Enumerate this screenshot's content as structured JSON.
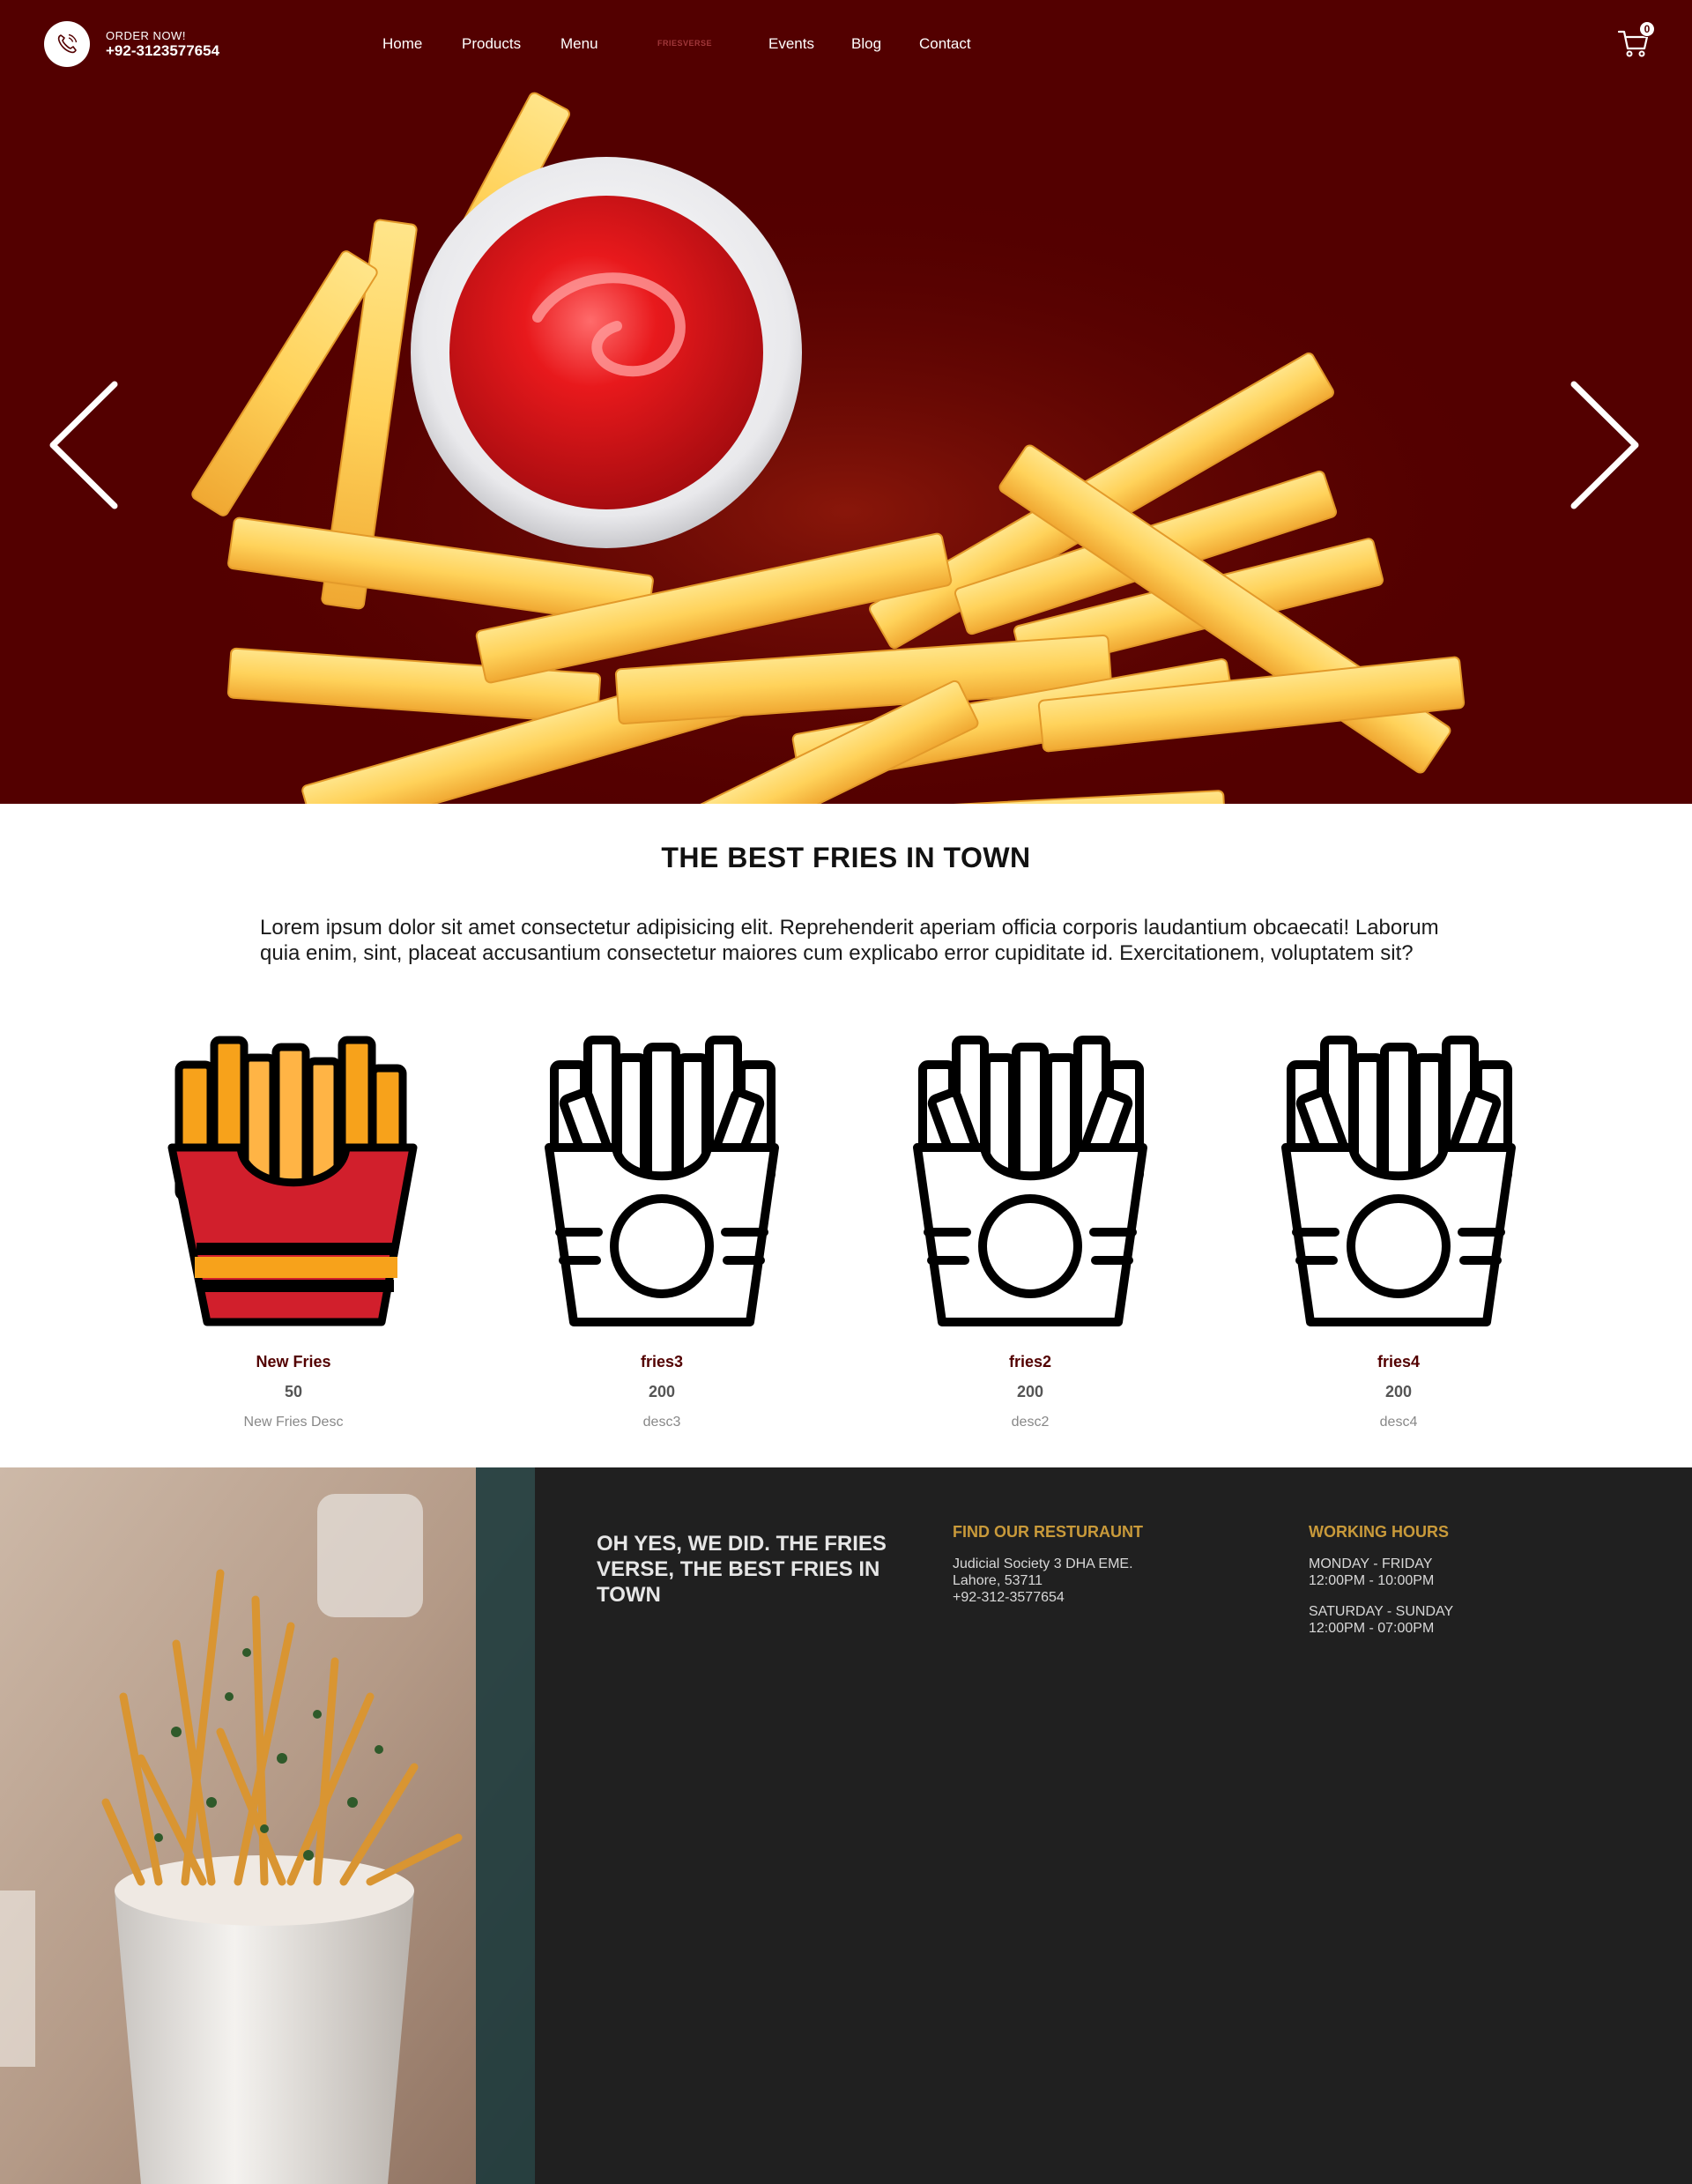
{
  "navbar": {
    "order_label": "ORDER NOW!",
    "order_phone": "+92-3123577654",
    "links": [
      "Home",
      "Products",
      "Menu",
      "Events",
      "Blog",
      "Contact"
    ],
    "logo_text": "FRIESVERSE",
    "cart_count": "0",
    "background": "#530000"
  },
  "hero": {
    "prev_icon": "chevron-left-icon",
    "next_icon": "chevron-right-icon",
    "background": "#530000"
  },
  "intro": {
    "title": "THE BEST FRIES IN TOWN",
    "text": "Lorem ipsum dolor sit amet consectetur adipisicing elit. Reprehenderit aperiam officia corporis laudantium obcaecati! Laborum quia enim, sint, placeat accusantium consectetur maiores cum explicabo error cupiditate id. Exercitationem, voluptatem sit?"
  },
  "products": [
    {
      "name": "New Fries",
      "price": "50",
      "desc": "New Fries Desc",
      "icon": "fries-colored-icon"
    },
    {
      "name": "fries3",
      "price": "200",
      "desc": "desc3",
      "icon": "fries-outline-icon"
    },
    {
      "name": "fries2",
      "price": "200",
      "desc": "desc2",
      "icon": "fries-outline-icon"
    },
    {
      "name": "fries4",
      "price": "200",
      "desc": "desc4",
      "icon": "fries-outline-icon"
    }
  ],
  "footer": {
    "tagline": "OH YES, WE DID. THE FRIES VERSE, THE BEST FRIES IN TOWN",
    "find_title": "FIND OUR RESTURAUNT",
    "address_line1": "Judicial Society 3 DHA EME.",
    "address_line2": "Lahore, 53711",
    "address_phone": "+92-312-3577654",
    "hours_title": "WORKING HOURS",
    "weekday_label": "MONDAY - FRIDAY",
    "weekday_hours": "12:00PM - 10:00PM",
    "weekend_label": "SATURDAY - SUNDAY",
    "weekend_hours": "12:00PM - 07:00PM",
    "accent": "#c99a3a",
    "background": "#202020"
  }
}
